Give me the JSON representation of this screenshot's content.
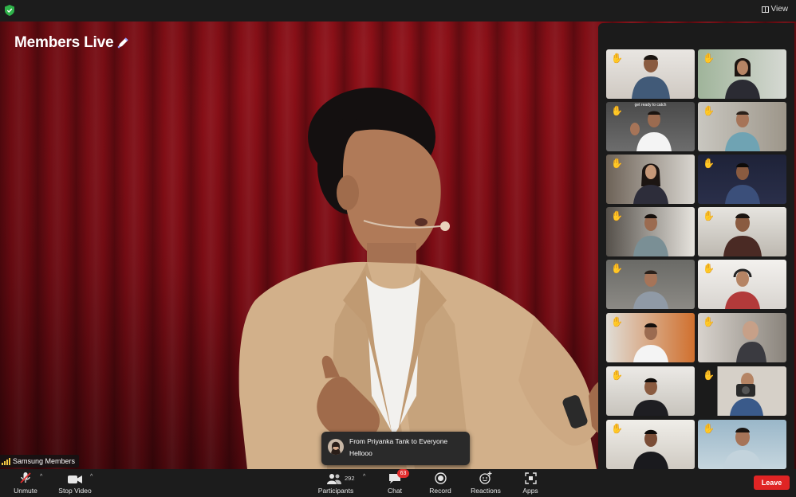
{
  "window": {
    "view_label": "View"
  },
  "stage": {
    "brand": "Members Live"
  },
  "gallery": {
    "tiles": [
      {
        "caption": ""
      },
      {
        "caption": ""
      },
      {
        "caption": "get ready to catch"
      },
      {
        "caption": ""
      },
      {
        "caption": ""
      },
      {
        "caption": ""
      },
      {
        "caption": ""
      },
      {
        "caption": ""
      },
      {
        "caption": ""
      },
      {
        "caption": ""
      },
      {
        "caption": ""
      },
      {
        "caption": ""
      },
      {
        "caption": ""
      },
      {
        "caption": ""
      },
      {
        "caption": ""
      },
      {
        "caption": ""
      }
    ]
  },
  "name_tag": {
    "label": "Samsung Members"
  },
  "chat_toast": {
    "from": "From Priyanka Tank to Everyone",
    "message": "Hellooo"
  },
  "toolbar": {
    "unmute": "Unmute",
    "stop_video": "Stop Video",
    "participants": "Participants",
    "participants_count": "292",
    "chat": "Chat",
    "chat_badge": "63",
    "record": "Record",
    "reactions": "Reactions",
    "apps": "Apps",
    "leave": "Leave"
  },
  "colors": {
    "curtain": "#8e1018",
    "leave": "#e02424",
    "badge": "#e02d2d",
    "raised_hand": "#f3c34a"
  },
  "icons": [
    "shield-icon",
    "grid-view-icon",
    "pen-icon",
    "raised-hand-icon",
    "muted-mic-icon",
    "video-camera-icon",
    "participants-icon",
    "chat-icon",
    "record-icon",
    "reactions-icon",
    "apps-icon",
    "signal-icon"
  ]
}
